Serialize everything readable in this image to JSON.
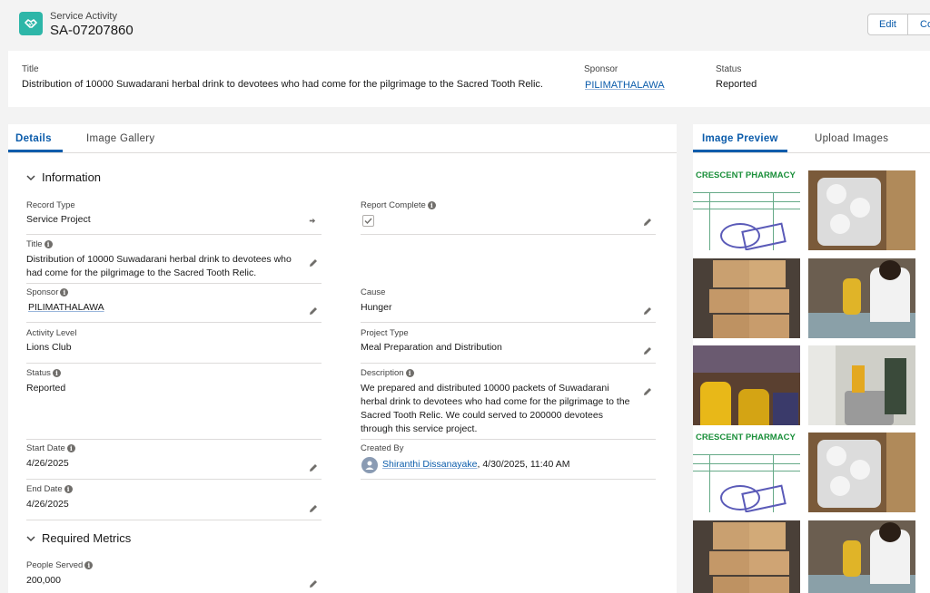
{
  "header": {
    "object_label": "Service Activity",
    "record_name": "SA-07207860",
    "buttons": [
      "Edit",
      "Co"
    ]
  },
  "highlights": {
    "title_label": "Title",
    "title_value": "Distribution of 10000 Suwadarani herbal drink to devotees who had come for the pilgrimage to the Sacred Tooth Relic.",
    "sponsor_label": "Sponsor",
    "sponsor_value": "PILIMATHALAWA",
    "status_label": "Status",
    "status_value": "Reported"
  },
  "left_tabs": [
    "Details",
    "Image Gallery"
  ],
  "right_tabs": [
    "Image Preview",
    "Upload Images"
  ],
  "sections": {
    "information": "Information",
    "required_metrics": "Required Metrics"
  },
  "fields": {
    "record_type": {
      "label": "Record Type",
      "value": "Service Project"
    },
    "report_complete": {
      "label": "Report Complete",
      "checked": true
    },
    "title": {
      "label": "Title",
      "value": "Distribution of 10000 Suwadarani herbal drink to devotees who had come for the pilgrimage to the Sacred Tooth Relic."
    },
    "sponsor": {
      "label": "Sponsor",
      "value": "PILIMATHALAWA"
    },
    "cause": {
      "label": "Cause",
      "value": "Hunger"
    },
    "activity_level": {
      "label": "Activity Level",
      "value": "Lions Club"
    },
    "project_type": {
      "label": "Project Type",
      "value": "Meal Preparation and Distribution"
    },
    "status": {
      "label": "Status",
      "value": "Reported"
    },
    "description": {
      "label": "Description",
      "value": "We prepared and distributed 10000 packets of Suwadarani herbal drink to devotees who had come for the pilgrimage to the Sacred Tooth Relic. We could served to 200000 devotees through this service project."
    },
    "start_date": {
      "label": "Start Date",
      "value": "4/26/2025"
    },
    "created_by": {
      "label": "Created By",
      "user": "Shiranthi Dissanayake",
      "date": ", 4/30/2025, 11:40 AM"
    },
    "end_date": {
      "label": "End Date",
      "value": "4/26/2025"
    },
    "people_served": {
      "label": "People Served",
      "value": "200,000"
    }
  },
  "gallery": {
    "pharmacy_text": "CRESCENT PHARMACY",
    "images": [
      "pharmacy-receipt",
      "plastic-cups",
      "stacked-boxes",
      "volunteers-packing",
      "volunteers-yellow",
      "volunteers-kitchen",
      "pharmacy-receipt",
      "plastic-cups",
      "stacked-boxes",
      "volunteers-packing"
    ]
  },
  "colors": {
    "brand_teal": "#2db6a8",
    "link_blue": "#0b5cab",
    "page_bg": "#f3f3f3"
  }
}
